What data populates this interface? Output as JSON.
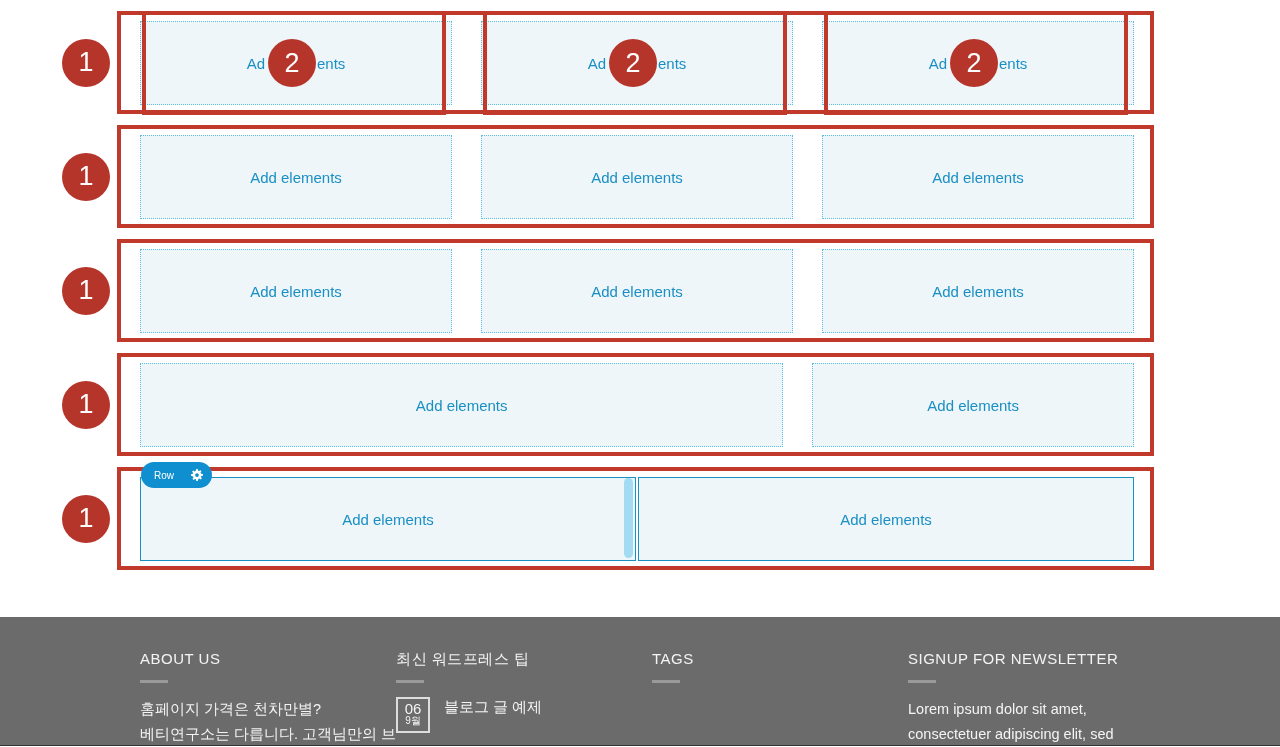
{
  "rows": [
    {
      "callout": "1",
      "active": false,
      "columns": [
        {
          "kind": "third",
          "fragments": [
            "Ad",
            "ents"
          ],
          "callout": "2"
        },
        {
          "kind": "third",
          "fragments": [
            "Ad",
            "ents"
          ],
          "callout": "2"
        },
        {
          "kind": "third",
          "fragments": [
            "Ad",
            "ents"
          ],
          "callout": "2"
        }
      ]
    },
    {
      "callout": "1",
      "active": false,
      "columns": [
        {
          "kind": "third",
          "label": "Add elements"
        },
        {
          "kind": "third",
          "label": "Add elements"
        },
        {
          "kind": "third",
          "label": "Add elements"
        }
      ]
    },
    {
      "callout": "1",
      "active": false,
      "columns": [
        {
          "kind": "third",
          "label": "Add elements"
        },
        {
          "kind": "third",
          "label": "Add elements"
        },
        {
          "kind": "third",
          "label": "Add elements"
        }
      ]
    },
    {
      "callout": "1",
      "active": false,
      "columns": [
        {
          "kind": "two-thirds",
          "label": "Add elements"
        },
        {
          "kind": "third",
          "label": "Add elements"
        }
      ]
    },
    {
      "callout": "1",
      "active": true,
      "tab": "Row",
      "columns": [
        {
          "kind": "half",
          "label": "Add elements"
        },
        {
          "kind": "half",
          "label": "Add elements"
        }
      ]
    }
  ],
  "footer": {
    "columns": [
      {
        "kind": "text",
        "title": "ABOUT US",
        "lines": [
          "홈페이지 가격은 천차만별?",
          "베티연구소는 다릅니다. 고객님만의 브"
        ]
      },
      {
        "kind": "posts",
        "title": "최신 워드프레스 팁",
        "posts": [
          {
            "day": "06",
            "month": "9월",
            "title": "블로그 글 예제"
          }
        ]
      },
      {
        "kind": "tags",
        "title": "TAGS"
      },
      {
        "kind": "text",
        "title": "SIGNUP FOR NEWSLETTER",
        "lines": [
          "Lorem ipsum dolor sit amet,",
          "consectetuer adipiscing elit, sed"
        ]
      }
    ]
  }
}
